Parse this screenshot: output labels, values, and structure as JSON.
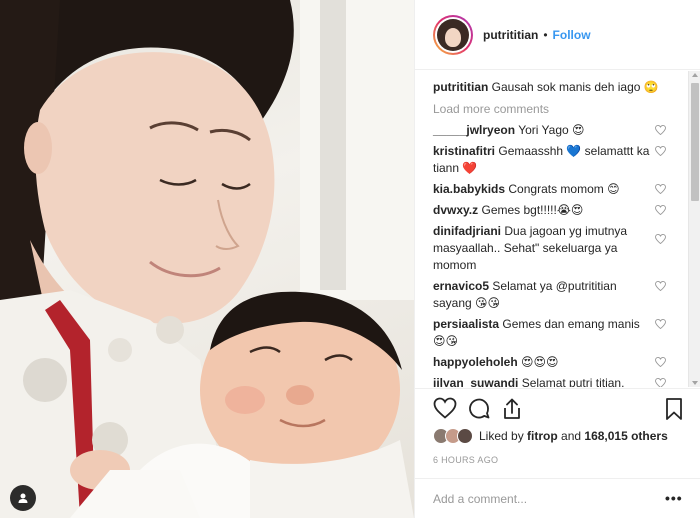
{
  "post": {
    "username": "putrititian",
    "follow_label": "Follow",
    "dot": "•"
  },
  "caption": {
    "user": "putrititian",
    "text": "Gausah sok manis deh iago 🙄"
  },
  "load_more_label": "Load more comments",
  "comments": [
    {
      "user": "_____jwlryeon",
      "text": "Yori Yago 😍"
    },
    {
      "user": "kristinafitri",
      "text": "Gemaasshh 💙 selamattt ka tiann ❤️"
    },
    {
      "user": "kia.babykids",
      "text": "Congrats momom 😊"
    },
    {
      "user": "dvwxy.z",
      "text": "Gemes bgt!!!!!😭😍"
    },
    {
      "user": "dinifadjriani",
      "text": "Dua jagoan yg imutnya masyaallah.. Sehat\" sekeluarga ya momom"
    },
    {
      "user": "ernavico5",
      "text": "Selamat ya @putrititian sayang 😘😘"
    },
    {
      "user": "persiaalista",
      "text": "Gemes dan emang manis 😍😘"
    },
    {
      "user": "happyoleholeh",
      "text": "😍😍😍"
    },
    {
      "user": "jilyan_suwandi",
      "text": "Selamat putri titian."
    }
  ],
  "likes": {
    "prefix": "Liked by ",
    "user": "fitrop",
    "middle": " and ",
    "count": "168,015 others"
  },
  "timestamp": "6 HOURS AGO",
  "add_comment_placeholder": "Add a comment...",
  "more_label": "•••",
  "icons": {
    "heart": "heart-icon",
    "comment": "comment-icon",
    "share": "share-icon",
    "bookmark": "bookmark-icon",
    "user_tag": "user-tag-icon"
  },
  "colors": {
    "link": "#3897f0",
    "muted": "#999999",
    "text": "#262626"
  }
}
